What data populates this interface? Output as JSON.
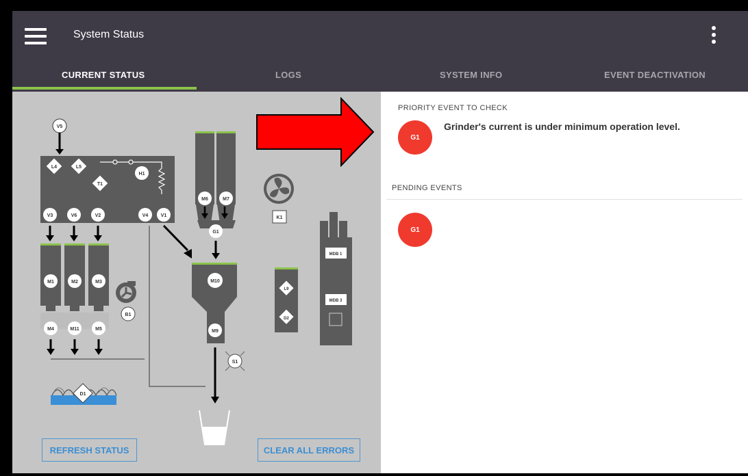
{
  "header": {
    "title": "System Status"
  },
  "tabs": [
    {
      "label": "CURRENT STATUS",
      "active": true
    },
    {
      "label": "LOGS",
      "active": false
    },
    {
      "label": "SYSTEM INFO",
      "active": false
    },
    {
      "label": "EVENT DEACTIVATION",
      "active": false
    }
  ],
  "diagram": {
    "nodes": {
      "v5": "V5",
      "l4": "L4",
      "l5": "L5",
      "t1": "T1",
      "h1": "H1",
      "v3": "V3",
      "v6": "V6",
      "v2": "V2",
      "v4": "V4",
      "v1": "V1",
      "m1": "M1",
      "m2": "M2",
      "m3": "M3",
      "m4": "M4",
      "m11": "M11",
      "m5": "M5",
      "b1": "B1",
      "d1": "D1",
      "m6": "M6",
      "m7": "M7",
      "g1": "G1",
      "m10": "M10",
      "m9": "M9",
      "s1": "S1",
      "k1": "K1",
      "l9": "L9",
      "d2": "D2",
      "mdb1": "MDB 1",
      "mdb3": "MDB 3"
    }
  },
  "actions": {
    "refresh": "REFRESH STATUS",
    "clear": "CLEAR ALL ERRORS"
  },
  "priority": {
    "heading": "PRIORITY EVENT TO CHECK",
    "badge": "G1",
    "message": "Grinder's current is under minimum operation level."
  },
  "pending": {
    "heading": "PENDING EVENTS",
    "badge": "G1"
  },
  "colors": {
    "appbar": "#3e3a46",
    "accent": "#8bc34a",
    "alert": "#f03a2e",
    "link": "#3c8fd3",
    "panel": "#c5c5c5",
    "machine": "#5b5b5b",
    "callout_arrow": "#ff0000"
  }
}
